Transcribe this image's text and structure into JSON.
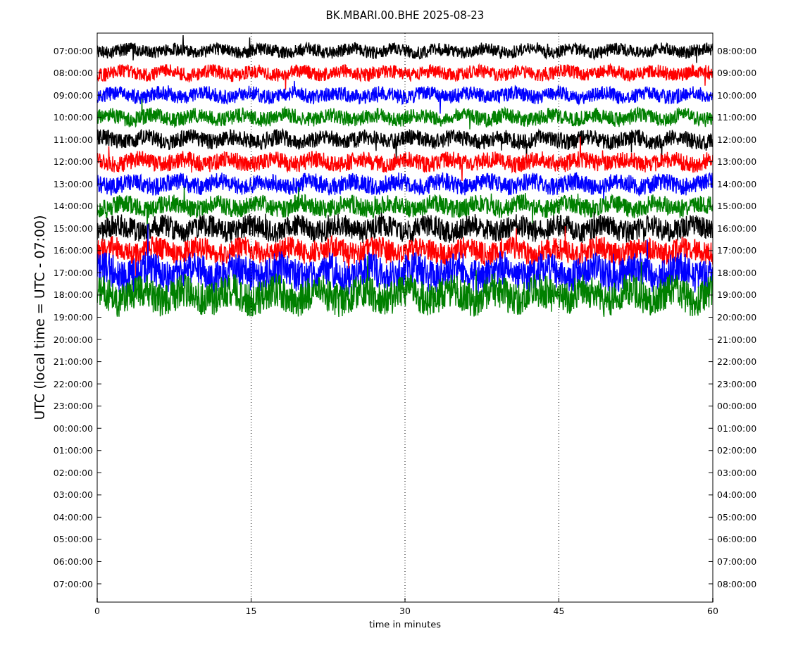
{
  "title": "BK.MBARI.00.BHE 2025-08-23",
  "ylabel": "UTC (local time = UTC - 07:00)",
  "xlabel": "time in minutes",
  "left_ticks": [
    "07:00:00",
    "08:00:00",
    "09:00:00",
    "10:00:00",
    "11:00:00",
    "12:00:00",
    "13:00:00",
    "14:00:00",
    "15:00:00",
    "16:00:00",
    "17:00:00",
    "18:00:00",
    "19:00:00",
    "20:00:00",
    "21:00:00",
    "22:00:00",
    "23:00:00",
    "00:00:00",
    "01:00:00",
    "02:00:00",
    "03:00:00",
    "04:00:00",
    "05:00:00",
    "06:00:00",
    "07:00:00"
  ],
  "right_ticks": [
    "08:00:00",
    "09:00:00",
    "10:00:00",
    "11:00:00",
    "12:00:00",
    "13:00:00",
    "14:00:00",
    "15:00:00",
    "16:00:00",
    "17:00:00",
    "18:00:00",
    "19:00:00",
    "20:00:00",
    "21:00:00",
    "22:00:00",
    "23:00:00",
    "00:00:00",
    "01:00:00",
    "02:00:00",
    "03:00:00",
    "04:00:00",
    "05:00:00",
    "06:00:00",
    "07:00:00",
    "08:00:00"
  ],
  "x_ticks": [
    "0",
    "15",
    "30",
    "45",
    "60"
  ],
  "traces": [
    {
      "color": "#000000"
    },
    {
      "color": "#ff0000"
    },
    {
      "color": "#0000ff"
    },
    {
      "color": "#008000"
    },
    {
      "color": "#000000"
    },
    {
      "color": "#ff0000"
    },
    {
      "color": "#0000ff"
    },
    {
      "color": "#008000"
    },
    {
      "color": "#000000"
    },
    {
      "color": "#ff0000"
    },
    {
      "color": "#0000ff"
    },
    {
      "color": "#008000"
    }
  ]
}
